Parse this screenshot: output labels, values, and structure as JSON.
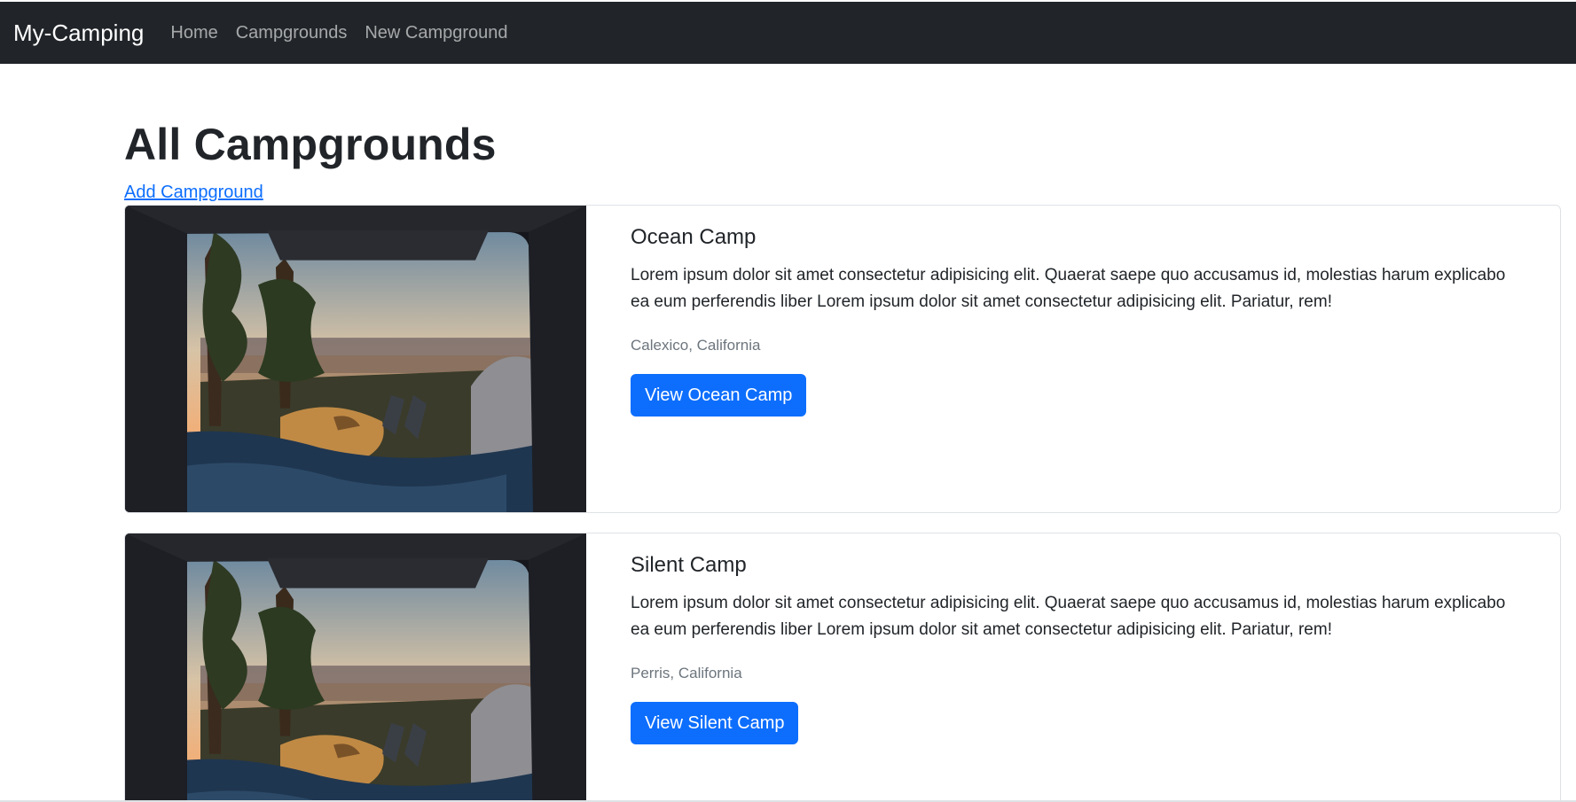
{
  "navbar": {
    "brand": "My-Camping",
    "links": [
      "Home",
      "Campgrounds",
      "New Campground"
    ]
  },
  "page": {
    "title": "All Campgrounds",
    "add_link": "Add Campground"
  },
  "campgrounds": [
    {
      "title": "Ocean Camp",
      "description": "Lorem ipsum dolor sit amet consectetur adipisicing elit. Quaerat saepe quo accusamus id, molestias harum explicabo ea eum perferendis liber Lorem ipsum dolor sit amet consectetur adipisicing elit. Pariatur, rem!",
      "location": "Calexico, California",
      "button": "View Ocean Camp"
    },
    {
      "title": "Silent Camp",
      "description": "Lorem ipsum dolor sit amet consectetur adipisicing elit. Quaerat saepe quo accusamus id, molestias harum explicabo ea eum perferendis liber Lorem ipsum dolor sit amet consectetur adipisicing elit. Pariatur, rem!",
      "location": "Perris, California",
      "button": "View Silent Camp"
    }
  ],
  "colors": {
    "navbar": "#212529",
    "primary": "#0d6efd",
    "muted": "#6c757d"
  }
}
